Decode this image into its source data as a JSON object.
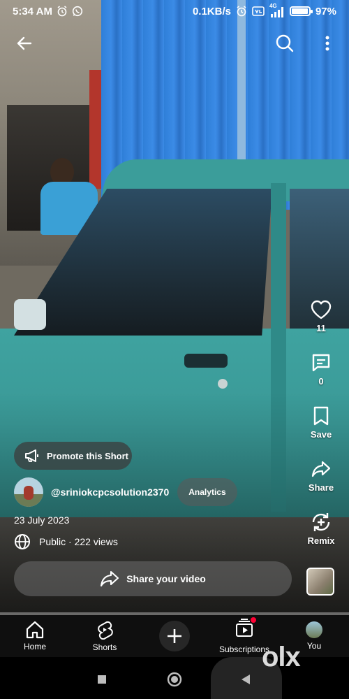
{
  "status_bar": {
    "time": "5:34 AM",
    "network_speed": "0.1KB/s",
    "network_type": "4G",
    "battery": "97%",
    "battery_level": 0.97
  },
  "top_bar": {
    "back_icon": "arrow-left-icon",
    "search_icon": "search-icon",
    "more_icon": "more-vert-icon"
  },
  "actions": {
    "like_count": "11",
    "comment_count": "0",
    "save_label": "Save",
    "share_label": "Share",
    "remix_label": "Remix"
  },
  "promote": {
    "label": "Promote this Short"
  },
  "channel": {
    "handle": "@sriniokcpcsolution2370",
    "analytics_label": "Analytics"
  },
  "meta": {
    "date": "23 July 2023",
    "visibility": "Public · 222 views"
  },
  "share_video": {
    "label": "Share your video"
  },
  "progress": {
    "fraction": 0.0
  },
  "nav": {
    "items": [
      {
        "label": "Home",
        "icon": "home-icon"
      },
      {
        "label": "Shorts",
        "icon": "shorts-icon"
      },
      {
        "label": "",
        "icon": "create-plus-icon"
      },
      {
        "label": "Subscriptions",
        "icon": "subscriptions-icon"
      },
      {
        "label": "You",
        "icon": "avatar"
      }
    ]
  },
  "watermark": "olx",
  "colors": {
    "accent": "#ff0033",
    "nav_bg": "#0f0f0f"
  }
}
